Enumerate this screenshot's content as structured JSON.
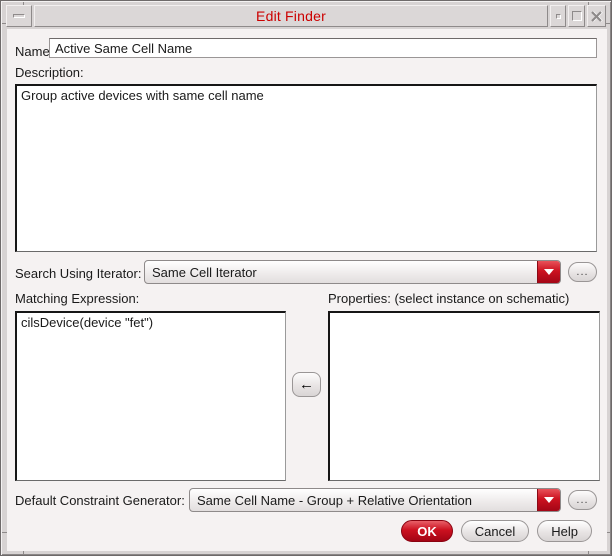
{
  "window": {
    "title": "Edit Finder"
  },
  "colors": {
    "title_red": "#cc0000",
    "accent_red": "#cc1120",
    "dialog_bg": "#f5f2f2",
    "frame_gray": "#d7d3d3"
  },
  "name_field": {
    "label": "Name:",
    "value": "Active Same Cell Name"
  },
  "description": {
    "label": "Description:",
    "value": "Group active devices with same cell name"
  },
  "iterator": {
    "label": "Search Using Iterator:",
    "value": "Same Cell Iterator",
    "browse_label": "..."
  },
  "matching": {
    "label": "Matching Expression:",
    "value": "cilsDevice(device \"fet\")"
  },
  "properties": {
    "label": "Properties: (select instance on schematic)",
    "value": ""
  },
  "transfer": {
    "arrow": "←"
  },
  "generator": {
    "label": "Default Constraint Generator:",
    "value": "Same Cell Name - Group + Relative Orientation",
    "browse_label": "..."
  },
  "footer": {
    "ok": "OK",
    "cancel": "Cancel",
    "help": "Help"
  }
}
